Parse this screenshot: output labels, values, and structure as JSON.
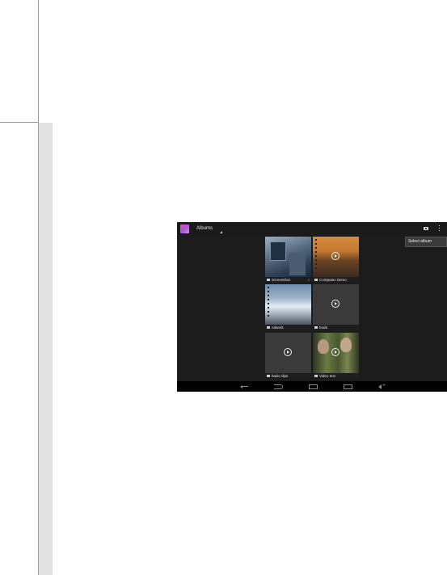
{
  "actionbar": {
    "title": "Albums",
    "app_icon": "gallery-app-icon",
    "camera_icon": "camera-icon",
    "overflow_icon": "overflow-menu-icon"
  },
  "menu": {
    "select_album": "Select album"
  },
  "albums": [
    {
      "name": "Screenshot",
      "count": "4",
      "thumb": "photo",
      "colors": [
        "#5d6f85",
        "#2b3c55"
      ]
    },
    {
      "name": "Computex Demo",
      "count": "",
      "thumb": "video",
      "colors": [
        "#c57a30",
        "#4a2a1a"
      ]
    },
    {
      "name": "ruland1",
      "count": "",
      "thumb": "photo",
      "colors": [
        "#7f97b2",
        "#e8eef5"
      ]
    },
    {
      "name": "boda",
      "count": "",
      "thumb": "video",
      "colors": [
        "#3a3a3a",
        "#3a3a3a"
      ]
    },
    {
      "name": "bado clips",
      "count": "",
      "thumb": "video",
      "colors": [
        "#3a3a3a",
        "#3a3a3a"
      ]
    },
    {
      "name": "Video test",
      "count": "",
      "thumb": "video",
      "colors": [
        "#5a6a3a",
        "#2e3522"
      ]
    }
  ],
  "navbar": {
    "icons": [
      "back-icon",
      "back-arrow-icon",
      "home-icon",
      "recent-apps-icon",
      "volume-icon"
    ]
  }
}
